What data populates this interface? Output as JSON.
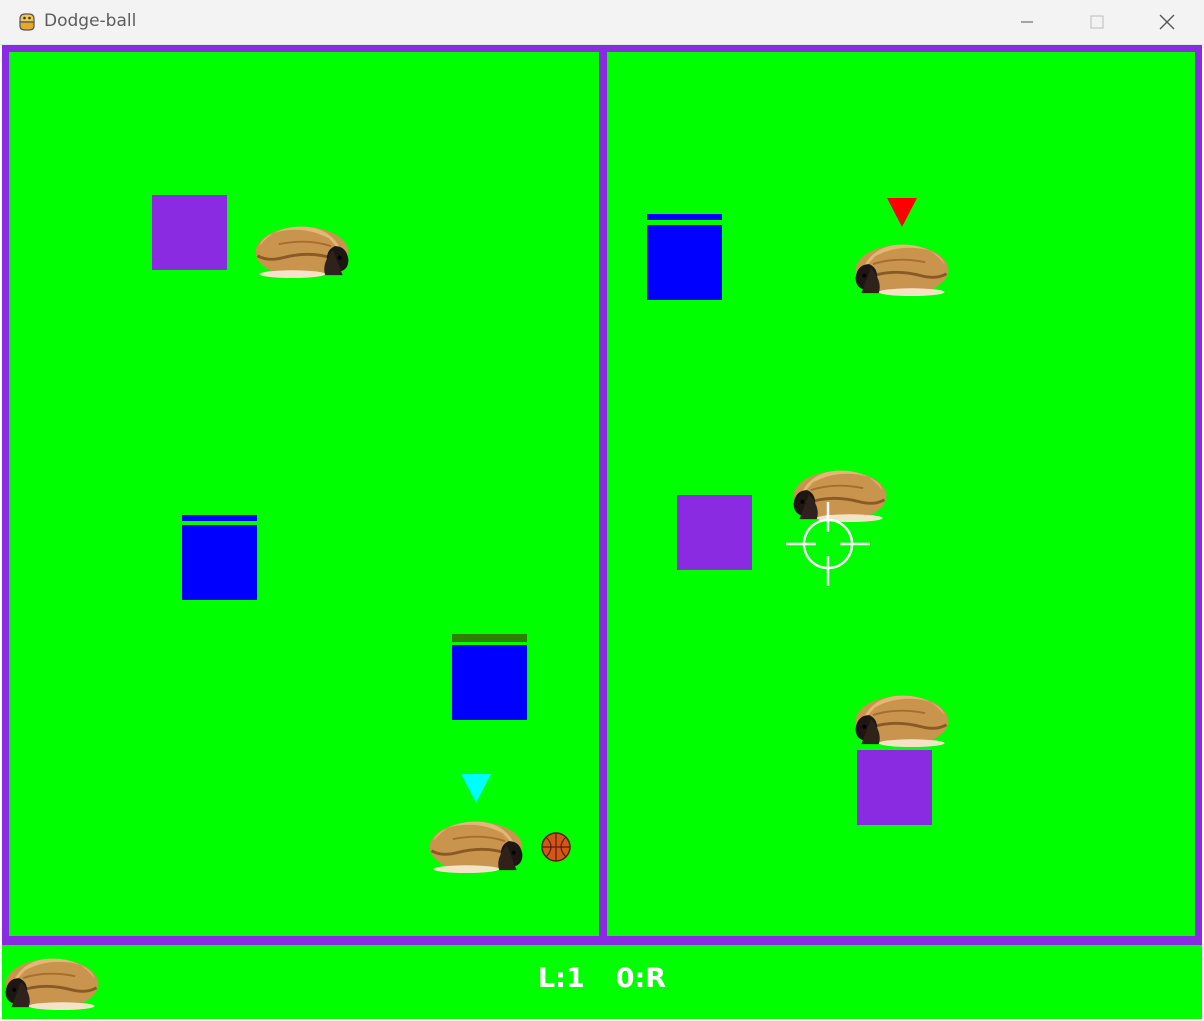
{
  "window": {
    "title": "Dodge-ball"
  },
  "icons": {
    "app": "python-icon",
    "minimize": "minimize-icon",
    "maximize": "maximize-icon",
    "close": "close-icon",
    "crosshair": "crosshair-icon",
    "ball": "basketball-icon"
  },
  "colors": {
    "field": "#00ff00",
    "border": "#8a2be2",
    "purple_box": "#8a2be2",
    "blue_box": "#0000ff",
    "left_team_marker": "#00ffff",
    "right_team_marker": "#ff0000",
    "full_health_bar": "#0000ff",
    "damaged_health_bar": "#2f7f00",
    "score_text": "#ffffff"
  },
  "scoreboard": {
    "text": "L:1   0:R"
  }
}
